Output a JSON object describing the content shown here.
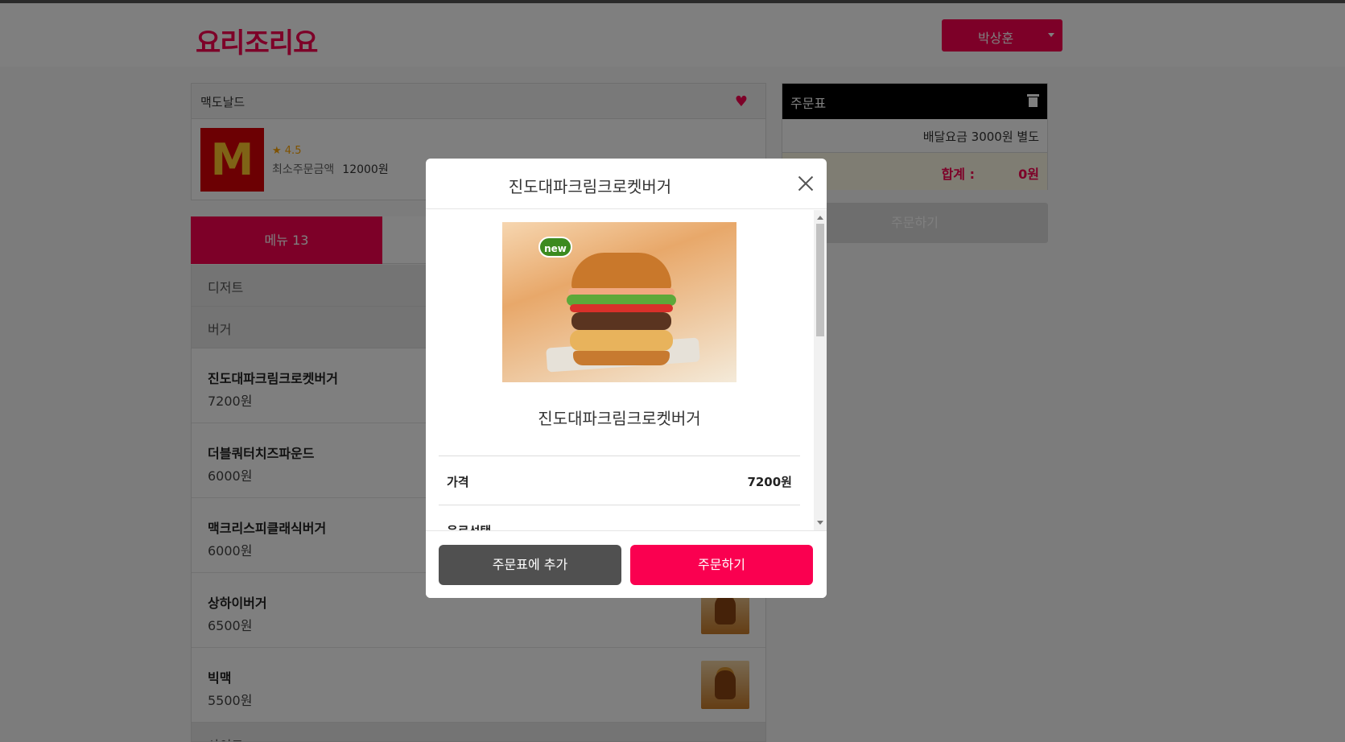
{
  "brand": {
    "logo_text": "요리조리요",
    "accent": "#fa0050"
  },
  "header": {
    "user_name": "박상훈"
  },
  "restaurant": {
    "name": "맥도날드",
    "logo_text": "M",
    "rating": "★ 4.5",
    "min_order_label": "최소주문금액",
    "min_order_value": "12000원"
  },
  "tabs": {
    "menu": "메뉴 13"
  },
  "menu": {
    "categories": [
      {
        "label": "디저트"
      },
      {
        "label": "버거"
      },
      {
        "label": "사이드"
      }
    ],
    "items": [
      {
        "name": "진도대파크림크로켓버거",
        "price": "7200원"
      },
      {
        "name": "더블쿼터치즈파운드",
        "price": "6000원"
      },
      {
        "name": "맥크리스피클래식버거",
        "price": "6000원"
      },
      {
        "name": "상하이버거",
        "price": "6500원"
      },
      {
        "name": "빅맥",
        "price": "5500원"
      }
    ]
  },
  "order_sheet": {
    "title": "주문표",
    "delivery_fee": "배달요금 3000원 별도",
    "total_label": "합계 :",
    "total_value": "0원",
    "order_button": "주문하기"
  },
  "modal": {
    "title": "진도대파크림크로켓버거",
    "badge": "new",
    "food_name": "진도대파크림크로켓버거",
    "price_label": "가격",
    "price_value": "7200원",
    "drink_label": "음료선택",
    "add_to_cart": "주문표에 추가",
    "order_now": "주문하기"
  },
  "icons": [
    "heart-icon",
    "trash-icon",
    "close-icon",
    "chevron-down-icon"
  ]
}
